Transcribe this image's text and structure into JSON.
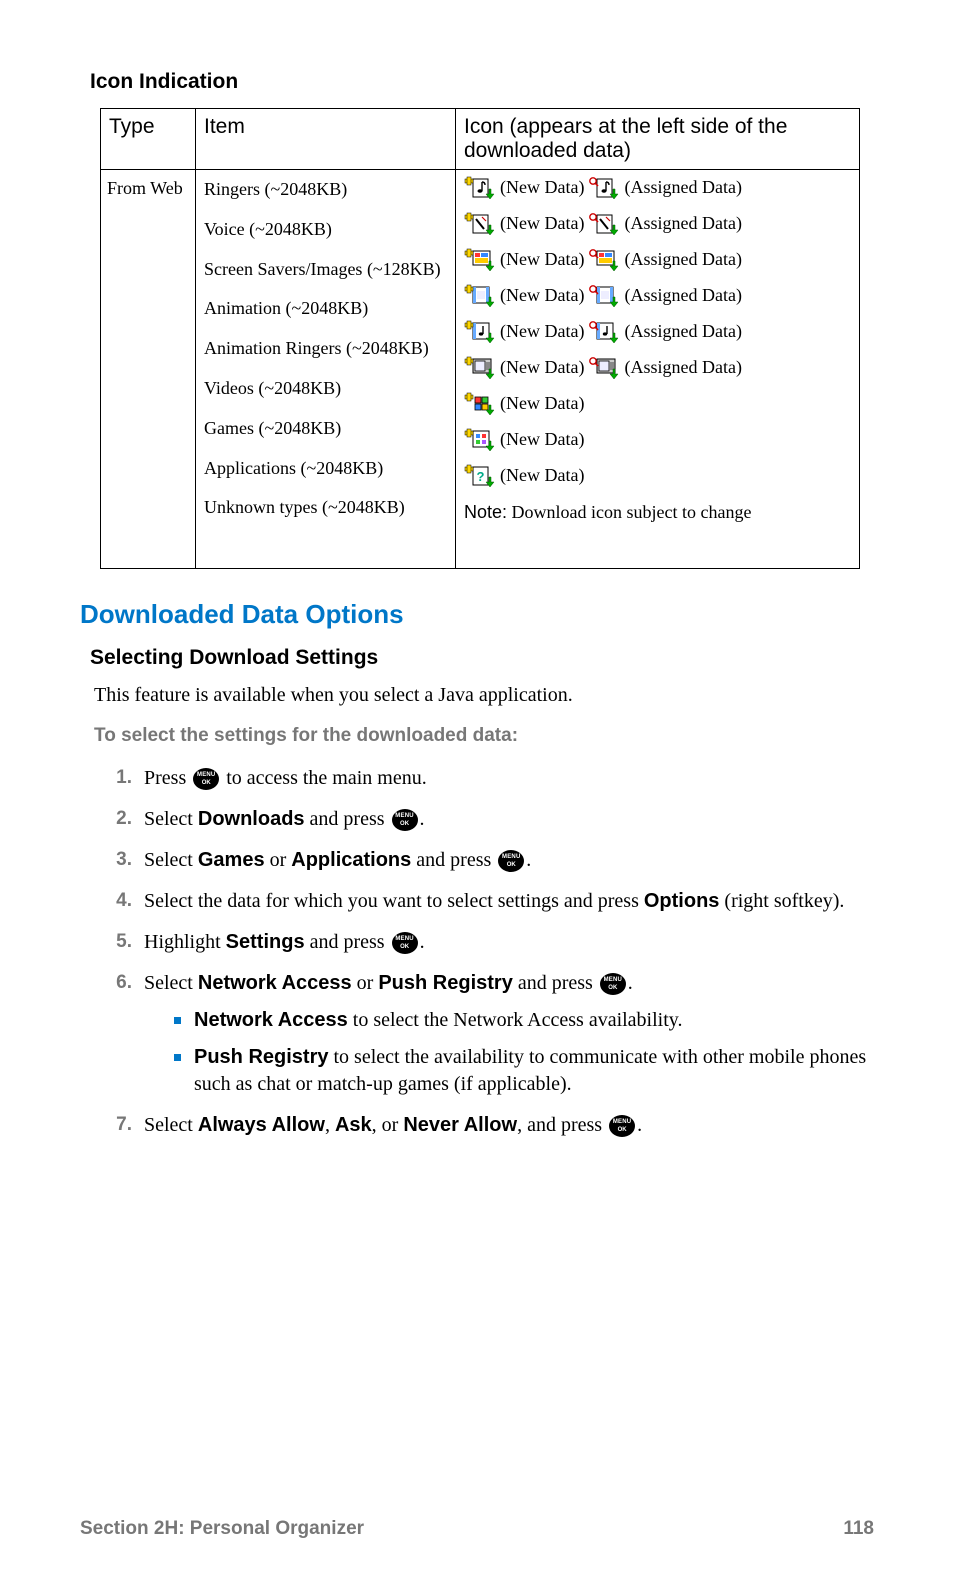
{
  "headings": {
    "icon_indication": "Icon Indication",
    "downloaded_data_options": "Downloaded Data Options",
    "selecting_download_settings": "Selecting Download Settings"
  },
  "table": {
    "headers": {
      "type": "Type",
      "item": "Item",
      "icon": "Icon (appears at the left side of the downloaded data)"
    },
    "type_value": "From Web",
    "rows": [
      {
        "item": "Ringers (~2048KB)",
        "icon_kind": "music",
        "new_data": "(New Data)",
        "assigned_data": "(Assigned Data)"
      },
      {
        "item": "Voice (~2048KB)",
        "icon_kind": "voice",
        "new_data": "(New Data)",
        "assigned_data": "(Assigned Data)"
      },
      {
        "item": "Screen Savers/Images (~128KB)",
        "icon_kind": "image",
        "new_data": "(New Data)",
        "assigned_data": "(Assigned Data)"
      },
      {
        "item": "Animation (~2048KB)",
        "icon_kind": "animation",
        "new_data": "(New Data)",
        "assigned_data": "(Assigned Data)"
      },
      {
        "item": "Animation Ringers (~2048KB)",
        "icon_kind": "anim_ringer",
        "new_data": "(New Data)",
        "assigned_data": "(Assigned Data)"
      },
      {
        "item": "Videos (~2048KB)",
        "icon_kind": "video",
        "new_data": "(New Data)",
        "assigned_data": "(Assigned Data)"
      },
      {
        "item": "Games (~2048KB)",
        "icon_kind": "game",
        "new_data": "(New Data)",
        "assigned_data": null
      },
      {
        "item": "Applications (~2048KB)",
        "icon_kind": "app",
        "new_data": "(New Data)",
        "assigned_data": null
      },
      {
        "item": "Unknown types (~2048KB)",
        "icon_kind": "unknown",
        "new_data": "(New Data)",
        "assigned_data": null
      }
    ],
    "note_label": "Note:",
    "note_text": " Download icon subject to change"
  },
  "paragraphs": {
    "intro": "This feature is available when you select a Java application.",
    "lead": "To select the settings for the downloaded data:"
  },
  "steps": [
    {
      "pre": "Press ",
      "post": " to access the main menu."
    },
    {
      "pre": "Select ",
      "bold1": "Downloads",
      "mid1": " and press ",
      "post": "."
    },
    {
      "pre": "Select ",
      "bold1": "Games",
      "mid1": " or ",
      "bold2": "Applications",
      "mid2": " and press ",
      "post": "."
    },
    {
      "pre": "Select the data for which you want to select settings and press ",
      "bold1": "Options",
      "post": " (right softkey)."
    },
    {
      "pre": "Highlight ",
      "bold1": "Settings",
      "mid1": " and press ",
      "post": "."
    },
    {
      "pre": "Select ",
      "bold1": "Network Access",
      "mid1": " or ",
      "bold2": "Push Registry",
      "mid2": " and press ",
      "post": "."
    },
    {
      "pre": "Select ",
      "bold1": "Always Allow",
      "mid1": ", ",
      "bold2": "Ask",
      "mid2": ", or ",
      "bold3": "Never Allow",
      "mid3": ", and press ",
      "post": "."
    }
  ],
  "sublist": [
    {
      "bold": "Network Access",
      "rest": " to select the Network Access availability."
    },
    {
      "bold": "Push Registry",
      "rest": " to select the availability to communicate with other mobile phones such as chat or match-up games (if applicable)."
    }
  ],
  "footer": {
    "section": "Section 2H: Personal Organizer",
    "page": "118"
  }
}
